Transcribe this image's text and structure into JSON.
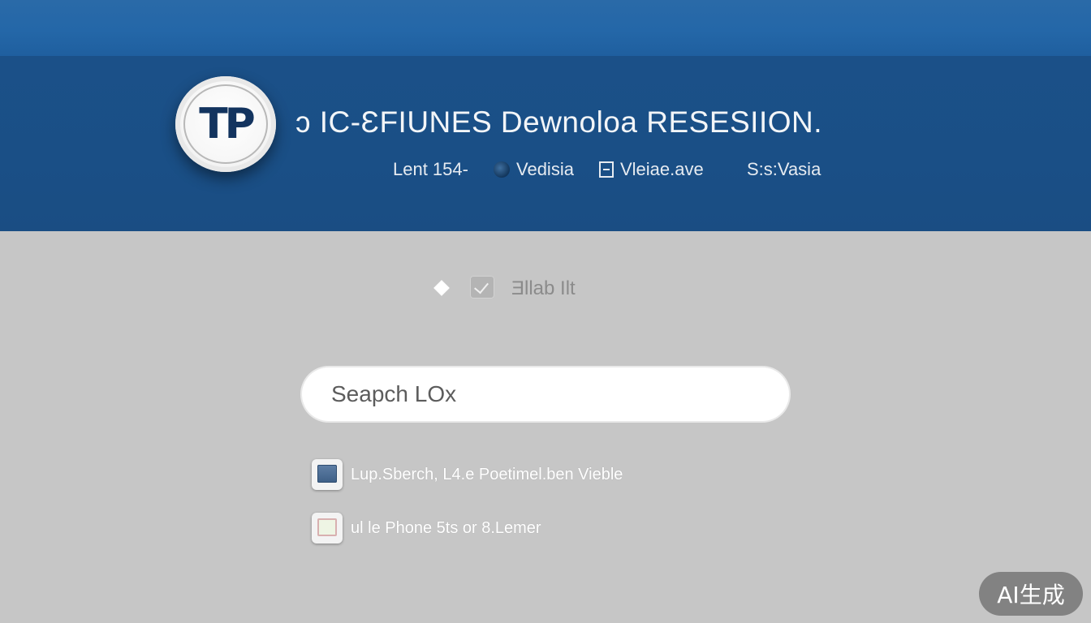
{
  "header": {
    "logo_text": "TP",
    "title": "ɔ IC-ƐFIUNES Dewnoloa RESESIION.",
    "subtitle": {
      "item1": "Lent 154-",
      "item2": "Vedisia",
      "item3": "Vleiae.ave",
      "item4": "S:s:Vasia"
    }
  },
  "toolbar": {
    "label": "Ǝllab Ilt"
  },
  "search": {
    "placeholder": "Seapch LOx"
  },
  "results": [
    {
      "text": "Lup.Sberch, L4.e Poetimel.ben Vieble"
    },
    {
      "text": "ul le Phone 5ts or 8.Lemer"
    }
  ],
  "badge": {
    "text": "AI生成"
  },
  "colors": {
    "top_strip": "#2467a8",
    "header_bg": "#1a4f86",
    "page_bg": "#c6c6c6",
    "search_bg": "#ffffff",
    "logo_text": "#13345f"
  },
  "icons": {
    "logo": "tp-logo-icon",
    "diamond": "diamond-icon",
    "check": "checkbox-icon",
    "dot": "circle-dot-icon",
    "file": "file-icon",
    "result1": "image-app-icon",
    "result2": "document-app-icon"
  }
}
